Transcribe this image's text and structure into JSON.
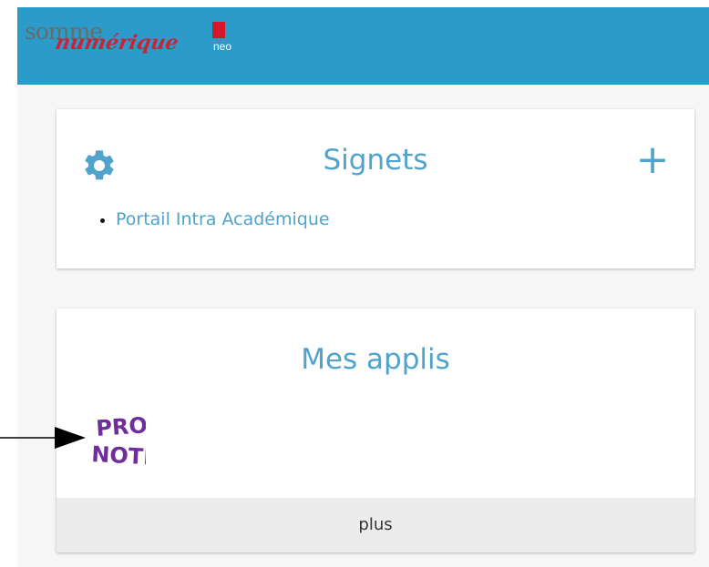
{
  "header": {
    "logo_word1": "somme",
    "logo_word2": "numérique",
    "logo_neo": "neo",
    "bg_color": "#2b9cc9"
  },
  "signets": {
    "title": "Signets",
    "settings_icon": "gear-icon",
    "add_icon": "plus-icon",
    "add_label": "+",
    "items": [
      {
        "label": "Portail Intra Académique"
      }
    ]
  },
  "applis": {
    "title": "Mes applis",
    "apps": [
      {
        "name": "PRONOTE",
        "line1": "PRO",
        "line2": "NOTE",
        "color": "#6e2f9c"
      }
    ],
    "more_label": "plus"
  },
  "colors": {
    "accent": "#4fa3cc",
    "header": "#2b9cc9",
    "brand_red": "#c8233a"
  }
}
